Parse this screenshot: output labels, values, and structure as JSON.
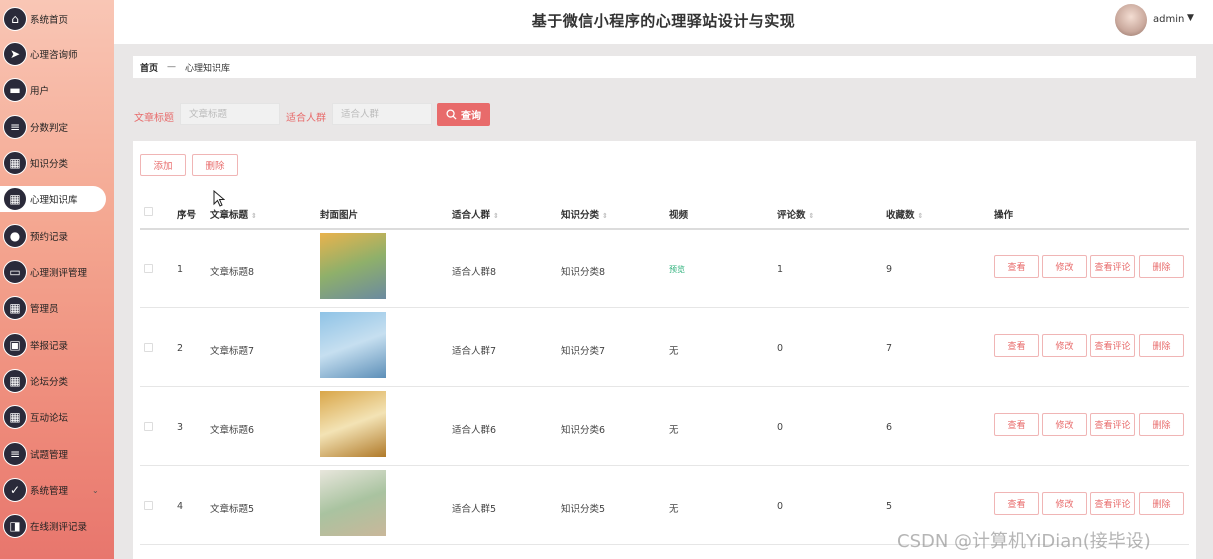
{
  "header": {
    "title": "基于微信小程序的心理驿站设计与实现",
    "user": "admin",
    "caret": "▼"
  },
  "sidebar": {
    "items": [
      {
        "label": "系统首页",
        "icon": "home-icon",
        "glyph": "⌂"
      },
      {
        "label": "心理咨询师",
        "icon": "send-icon",
        "glyph": "➤"
      },
      {
        "label": "用户",
        "icon": "ticket-icon",
        "glyph": "▬"
      },
      {
        "label": "分数判定",
        "icon": "list-icon",
        "glyph": "≡"
      },
      {
        "label": "知识分类",
        "icon": "grid-icon",
        "glyph": "▦"
      },
      {
        "label": "心理知识库",
        "icon": "grid-icon",
        "glyph": "▦",
        "active": true
      },
      {
        "label": "预约记录",
        "icon": "bulb-icon",
        "glyph": "●"
      },
      {
        "label": "心理测评管理",
        "icon": "chat-icon",
        "glyph": "▭"
      },
      {
        "label": "管理员",
        "icon": "grid-icon",
        "glyph": "▦"
      },
      {
        "label": "举报记录",
        "icon": "briefcase-icon",
        "glyph": "▣"
      },
      {
        "label": "论坛分类",
        "icon": "grid-icon",
        "glyph": "▦"
      },
      {
        "label": "互动论坛",
        "icon": "grid-icon",
        "glyph": "▦"
      },
      {
        "label": "试题管理",
        "icon": "sliders-icon",
        "glyph": "≡"
      },
      {
        "label": "系统管理",
        "icon": "clipboard-icon",
        "glyph": "✓",
        "has_chevron": true,
        "chevron": "⌄"
      },
      {
        "label": "在线测评记录",
        "icon": "wallet-icon",
        "glyph": "◨"
      }
    ]
  },
  "breadcrumb": {
    "home": "首页",
    "separator": "—",
    "current": "心理知识库"
  },
  "search": {
    "title_label": "文章标题",
    "title_placeholder": "文章标题",
    "crowd_label": "适合人群",
    "crowd_placeholder": "适合人群",
    "button": "查询"
  },
  "toolbar": {
    "add": "添加",
    "delete": "删除"
  },
  "table": {
    "headers": {
      "index": "序号",
      "title": "文章标题",
      "cover": "封面图片",
      "crowd": "适合人群",
      "category": "知识分类",
      "video": "视频",
      "comments": "评论数",
      "favorites": "收藏数",
      "actions": "操作"
    },
    "sort_glyph": "⇕",
    "rows": [
      {
        "index": "1",
        "title": "文章标题8",
        "crowd": "适合人群8",
        "category": "知识分类8",
        "video": "预览",
        "video_is_link": true,
        "comments": "1",
        "favorites": "9",
        "cover_colors": [
          "#e9b34d",
          "#8fb06a",
          "#6b8aa0"
        ]
      },
      {
        "index": "2",
        "title": "文章标题7",
        "crowd": "适合人群7",
        "category": "知识分类7",
        "video": "无",
        "video_is_link": false,
        "comments": "0",
        "favorites": "7",
        "cover_colors": [
          "#8fc3e6",
          "#c6dff0",
          "#5d8fb8"
        ]
      },
      {
        "index": "3",
        "title": "文章标题6",
        "crowd": "适合人群6",
        "category": "知识分类6",
        "video": "无",
        "video_is_link": false,
        "comments": "0",
        "favorites": "6",
        "cover_colors": [
          "#d9a649",
          "#f3e3b5",
          "#b07a2a"
        ]
      },
      {
        "index": "4",
        "title": "文章标题5",
        "crowd": "适合人群5",
        "category": "知识分类5",
        "video": "无",
        "video_is_link": false,
        "comments": "0",
        "favorites": "5",
        "cover_colors": [
          "#e8e6dc",
          "#a9c3a0",
          "#c9b79a"
        ]
      }
    ],
    "actions": {
      "view": "查看",
      "edit": "修改",
      "view_comments": "查看评论",
      "delete": "删除"
    }
  },
  "watermark": "CSDN @计算机YiDian(接毕设)"
}
